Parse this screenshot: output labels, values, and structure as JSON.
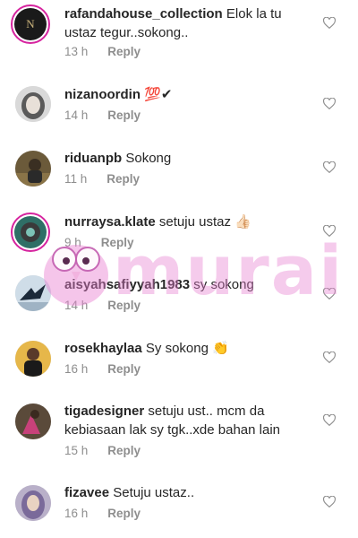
{
  "comments": [
    {
      "username": "rafandahouse_collection",
      "text": "Elok la tu\nustaz tegur..sokong..",
      "time": "13 h",
      "reply": "Reply",
      "avatar": "dark-logo-avatar",
      "story_ring": true
    },
    {
      "username": "nizanoordin",
      "text": "💯✔",
      "time": "14 h",
      "reply": "Reply",
      "avatar": "woman-hijab-avatar",
      "story_ring": false
    },
    {
      "username": "riduanpb",
      "text": "Sokong",
      "time": "11 h",
      "reply": "Reply",
      "avatar": "man-outdoor-avatar",
      "story_ring": false
    },
    {
      "username": "nurraysa.klate",
      "text": "setuju ustaz 👍🏻",
      "time": "9 h",
      "reply": "Reply",
      "avatar": "teal-circle-avatar",
      "story_ring": true
    },
    {
      "username": "aisyahsafiyyah1983",
      "text": "sy sokong",
      "time": "14 h",
      "reply": "Reply",
      "avatar": "bird-sky-avatar",
      "story_ring": false
    },
    {
      "username": "rosekhaylaa",
      "text": "Sy sokong 👏",
      "time": "16 h",
      "reply": "Reply",
      "avatar": "woman-black-outfit-avatar",
      "story_ring": false
    },
    {
      "username": "tigadesigner",
      "text": "setuju ust.. mcm da\nkebiasaan lak sy tgk..xde bahan lain",
      "time": "15 h",
      "reply": "Reply",
      "avatar": "pink-outdoor-avatar",
      "story_ring": false
    },
    {
      "username": "fizavee",
      "text": "Setuju ustaz..",
      "time": "16 h",
      "reply": "Reply",
      "avatar": "woman-hijab-purple-avatar",
      "story_ring": false
    }
  ],
  "watermark": {
    "text": "murai",
    "icon": "owl-mascot-icon"
  },
  "colors": {
    "accent_ring": "#d6249f",
    "watermark": "#e87fd0",
    "meta": "#8e8e8e"
  }
}
